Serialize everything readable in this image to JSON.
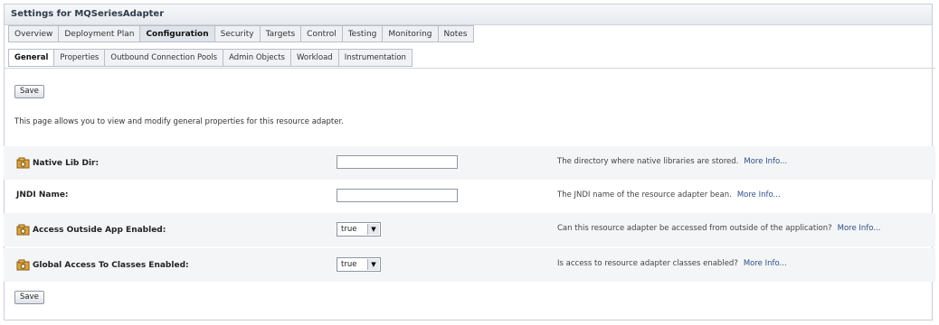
{
  "title": "Settings for MQSeriesAdapter",
  "tabs_main": [
    {
      "label": "Overview"
    },
    {
      "label": "Deployment Plan"
    },
    {
      "label": "Configuration",
      "active": true
    },
    {
      "label": "Security"
    },
    {
      "label": "Targets"
    },
    {
      "label": "Control"
    },
    {
      "label": "Testing"
    },
    {
      "label": "Monitoring"
    },
    {
      "label": "Notes"
    }
  ],
  "tabs_sub": [
    {
      "label": "General",
      "active": true
    },
    {
      "label": "Properties"
    },
    {
      "label": "Outbound Connection Pools"
    },
    {
      "label": "Admin Objects"
    },
    {
      "label": "Workload"
    },
    {
      "label": "Instrumentation"
    }
  ],
  "save_label": "Save",
  "description": "This page allows you to view and modify general properties for this resource adapter.",
  "fields": [
    {
      "label": "Native Lib Dir:",
      "icon": "config-icon",
      "kind": "text",
      "value": "",
      "help": "The directory where native libraries are stored.",
      "more": "More Info..."
    },
    {
      "label": "JNDI Name:",
      "icon": "",
      "kind": "text",
      "value": "",
      "help": "The JNDI name of the resource adapter bean.",
      "more": "More Info..."
    },
    {
      "label": "Access Outside App Enabled:",
      "icon": "config-icon",
      "kind": "select",
      "value": "true",
      "help": "Can this resource adapter be accessed from outside of the application?",
      "more": "More Info..."
    },
    {
      "label": "Global Access To Classes Enabled:",
      "icon": "config-icon",
      "kind": "select",
      "value": "true",
      "help": "Is access to resource adapter classes enabled?",
      "more": "More Info..."
    }
  ]
}
